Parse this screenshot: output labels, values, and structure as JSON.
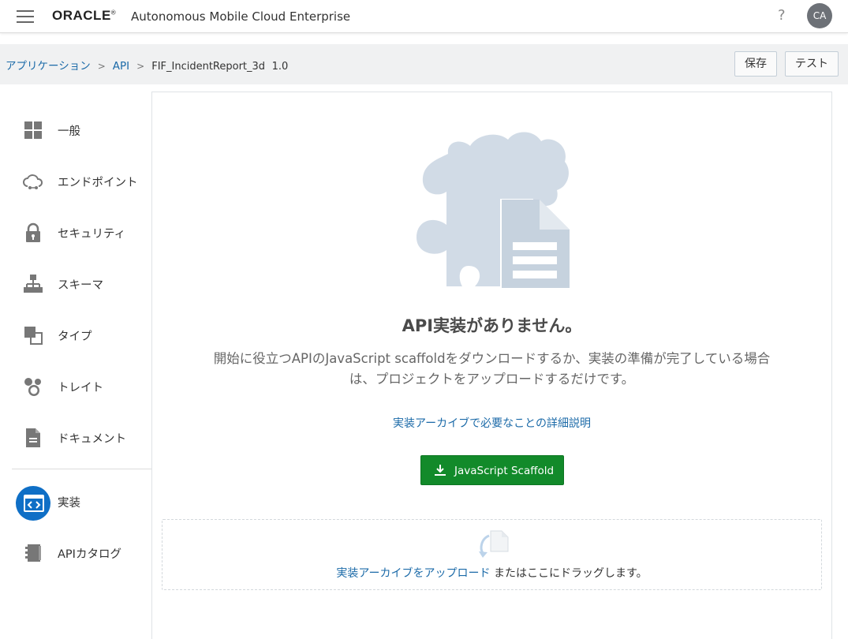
{
  "header": {
    "logo": "ORACLE",
    "logo_mark": "®",
    "app_title": "Autonomous Mobile Cloud Enterprise",
    "help": "?",
    "avatar_initials": "CA"
  },
  "breadcrumb": {
    "items": [
      "アプリケーション",
      "API"
    ],
    "separator": ">",
    "current": "FIF_IncidentReport_3d",
    "version": "1.0"
  },
  "toolbar": {
    "save_label": "保存",
    "test_label": "テスト"
  },
  "sidebar": {
    "items": [
      {
        "label": "一般",
        "icon": "grid-icon"
      },
      {
        "label": "エンドポイント",
        "icon": "cloud-icon"
      },
      {
        "label": "セキュリティ",
        "icon": "lock-icon"
      },
      {
        "label": "スキーマ",
        "icon": "hierarchy-icon"
      },
      {
        "label": "タイプ",
        "icon": "shapes-icon"
      },
      {
        "label": "トレイト",
        "icon": "circles-icon"
      },
      {
        "label": "ドキュメント",
        "icon": "document-icon"
      },
      {
        "label": "実装",
        "icon": "code-icon",
        "active": true
      },
      {
        "label": "APIカタログ",
        "icon": "catalog-icon"
      }
    ]
  },
  "main": {
    "empty_title": "API実装がありません。",
    "description": "開始に役立つAPIのJavaScript scaffoldをダウンロードするか、実装の準備が完了している場合は、プロジェクトをアップロードするだけです。",
    "learn_link": "実装アーカイブで必要なことの詳細説明",
    "scaffold_button": "JavaScript Scaffold",
    "upload_link": "実装アーカイブをアップロード",
    "upload_suffix": " またはここにドラッグします。"
  },
  "colors": {
    "accent": "#0f6fc6",
    "link": "#1b6aa8",
    "primary_button": "#128a2a",
    "illustration": "#d1dbe6"
  }
}
